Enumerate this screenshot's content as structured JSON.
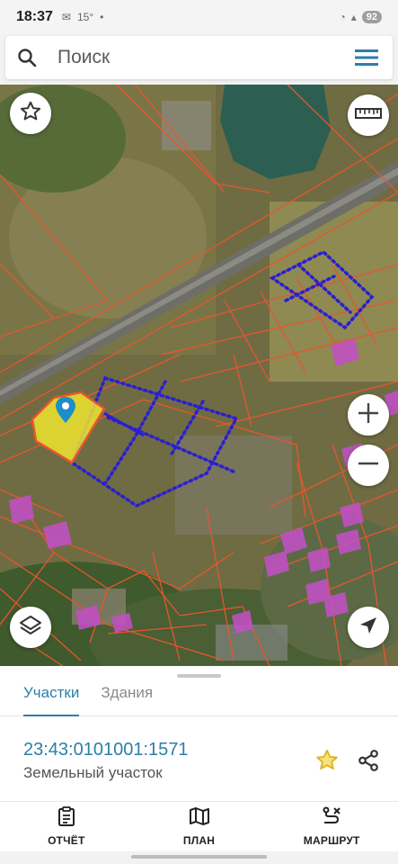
{
  "status_bar": {
    "time": "18:37",
    "temperature": "15°",
    "battery": "92"
  },
  "search": {
    "placeholder": "Поиск"
  },
  "icons": {
    "search": "search-icon",
    "menu": "hamburger-menu-icon",
    "favorite": "star-outline-icon",
    "ruler": "ruler-icon",
    "zoom_in": "plus-icon",
    "zoom_out": "minus-icon",
    "layers": "layers-icon",
    "locate": "navigation-arrow-icon",
    "parcel_favorite": "star-icon",
    "share": "share-icon",
    "report": "clipboard-icon",
    "plan": "map-icon",
    "route": "route-icon",
    "pin": "location-pin-icon"
  },
  "tabs": [
    {
      "label": "Участки",
      "active": true
    },
    {
      "label": "Здания",
      "active": false
    }
  ],
  "parcel": {
    "cadastral_number": "23:43:0101001:1571",
    "type": "Земельный участок"
  },
  "bottom_nav": [
    {
      "label": "ОТЧЁТ"
    },
    {
      "label": "ПЛАН"
    },
    {
      "label": "МАРШРУТ"
    }
  ],
  "colors": {
    "accent": "#2b7fa8",
    "parcel_border": "#e8552f",
    "selected_parcel": "#f2ea2e",
    "building_overlay": "#c44fc9",
    "dotted_boundary": "#2a1fd1",
    "favorite_star": "#e1b325"
  }
}
